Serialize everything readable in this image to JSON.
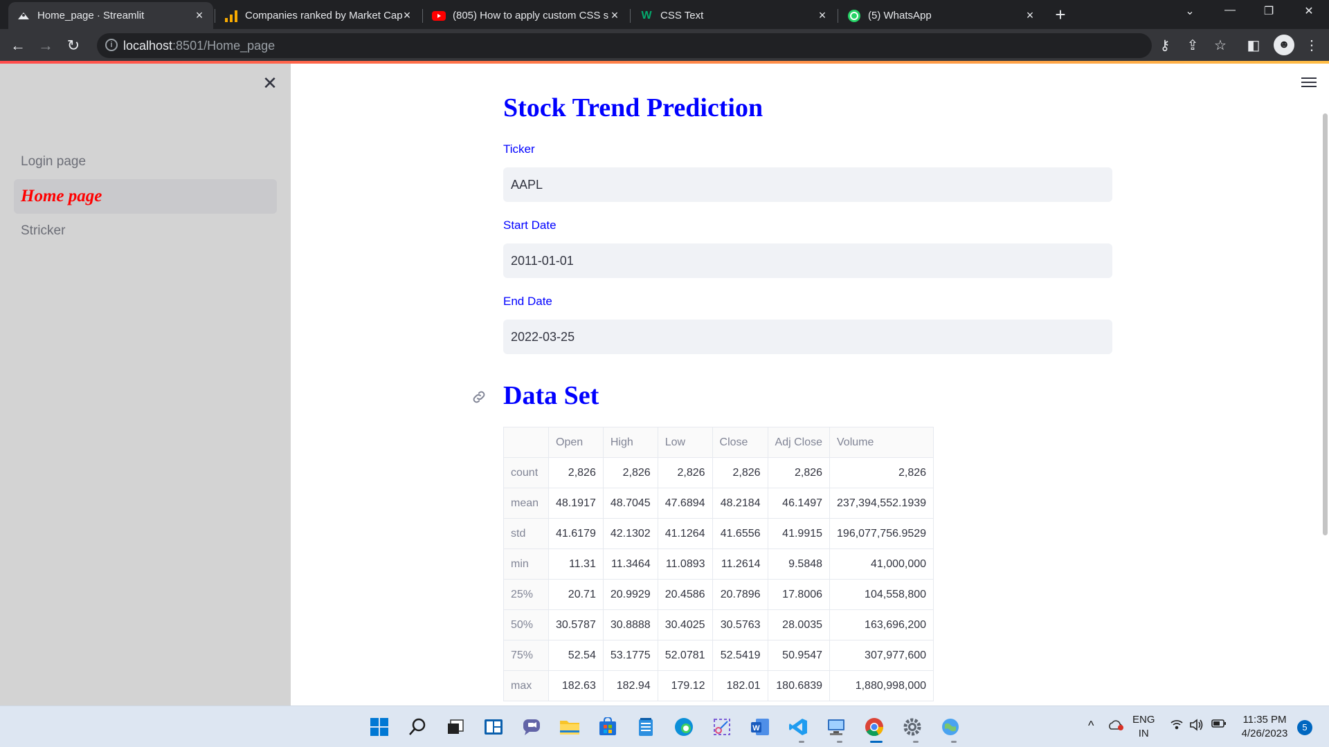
{
  "browser": {
    "tabs": [
      {
        "title": "Home_page · Streamlit",
        "active": true
      },
      {
        "title": "Companies ranked by Market Cap",
        "active": false
      },
      {
        "title": "(805) How to apply custom CSS s",
        "active": false
      },
      {
        "title": "CSS Text",
        "active": false
      },
      {
        "title": "(5) WhatsApp",
        "active": false
      }
    ],
    "url_host": "localhost",
    "url_rest": ":8501/Home_page"
  },
  "sidebar": {
    "items": [
      {
        "label": "Login page"
      },
      {
        "label": "Home page"
      },
      {
        "label": "Stricker"
      }
    ]
  },
  "main": {
    "title": "Stock Trend Prediction",
    "fields": {
      "ticker": {
        "label": "Ticker",
        "value": "AAPL"
      },
      "start_date": {
        "label": "Start Date",
        "value": "2011-01-01"
      },
      "end_date": {
        "label": "End Date",
        "value": "2022-03-25"
      }
    },
    "dataset_heading": "Data Set",
    "table": {
      "columns": [
        "",
        "Open",
        "High",
        "Low",
        "Close",
        "Adj Close",
        "Volume"
      ],
      "rows": [
        [
          "count",
          "2,826",
          "2,826",
          "2,826",
          "2,826",
          "2,826",
          "2,826"
        ],
        [
          "mean",
          "48.1917",
          "48.7045",
          "47.6894",
          "48.2184",
          "46.1497",
          "237,394,552.1939"
        ],
        [
          "std",
          "41.6179",
          "42.1302",
          "41.1264",
          "41.6556",
          "41.9915",
          "196,077,756.9529"
        ],
        [
          "min",
          "11.31",
          "11.3464",
          "11.0893",
          "11.2614",
          "9.5848",
          "41,000,000"
        ],
        [
          "25%",
          "20.71",
          "20.9929",
          "20.4586",
          "20.7896",
          "17.8006",
          "104,558,800"
        ],
        [
          "50%",
          "30.5787",
          "30.8888",
          "30.4025",
          "30.5763",
          "28.0035",
          "163,696,200"
        ],
        [
          "75%",
          "52.54",
          "53.1775",
          "52.0781",
          "52.5419",
          "50.9547",
          "307,977,600"
        ],
        [
          "max",
          "182.63",
          "182.94",
          "179.12",
          "182.01",
          "180.6839",
          "1,880,998,000"
        ]
      ]
    }
  },
  "taskbar": {
    "lang_top": "ENG",
    "lang_bottom": "IN",
    "time": "11:35 PM",
    "date": "4/26/2023",
    "notification_count": "5"
  },
  "colors": {
    "accent_blue": "#0000ff",
    "active_page_red": "#ff0000",
    "sidebar_bg": "#d3d3d3",
    "input_bg": "#f0f2f6"
  }
}
